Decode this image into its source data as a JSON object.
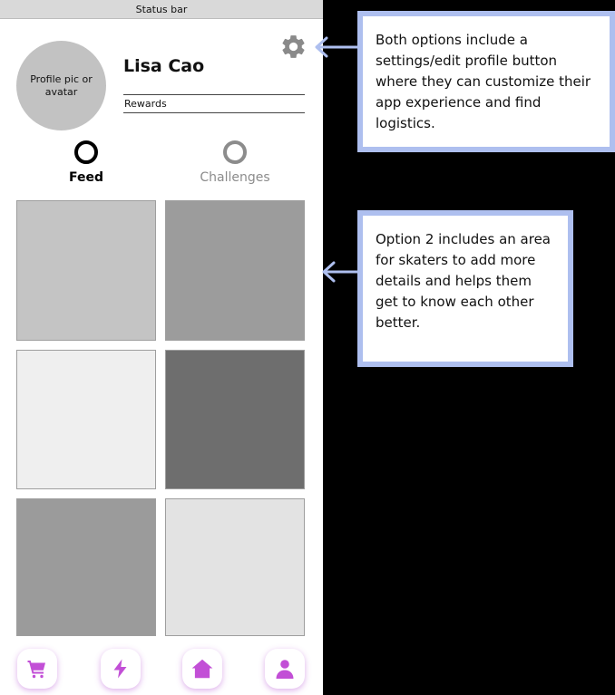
{
  "status_bar": {
    "label": "Status bar"
  },
  "profile": {
    "avatar_label": "Profile pic or avatar",
    "name": "Lisa Cao",
    "rewards_label": "Rewards",
    "settings_icon": "gear-icon"
  },
  "tabs": [
    {
      "label": "Feed",
      "active": true
    },
    {
      "label": "Challenges",
      "active": false
    }
  ],
  "feed_tiles": [
    {
      "color": "#c4c4c4"
    },
    {
      "color": "#9c9c9c"
    },
    {
      "color": "#efefef"
    },
    {
      "color": "#6e6e6e"
    },
    {
      "color": "#9b9b9b"
    },
    {
      "color": "#e3e3e3"
    }
  ],
  "bottom_nav": [
    {
      "icon": "cart-icon"
    },
    {
      "icon": "lightning-icon"
    },
    {
      "icon": "home-icon"
    },
    {
      "icon": "profile-icon"
    }
  ],
  "annotations": [
    {
      "text": "Both options include a settings/edit profile button where they can customize their app experience and find logistics."
    },
    {
      "text": "Option 2 includes an area for skaters to add more details and helps them get to know each other better."
    }
  ],
  "colors": {
    "background": "#000000",
    "accent_nav": "#c24fd6",
    "callout_border": "#aebfef",
    "gear": "#8a8a8a"
  }
}
